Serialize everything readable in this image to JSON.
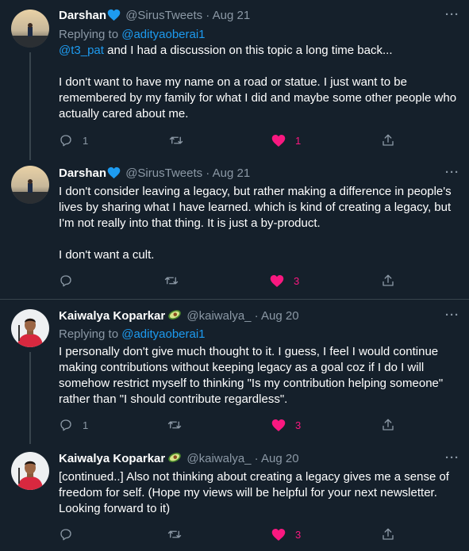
{
  "tweets": [
    {
      "name": "Darshan",
      "handle": "@SirusTweets",
      "sep": "·",
      "date": "Aug 21",
      "replying_prefix": "Replying to",
      "replying_to": "@adityaoberai1",
      "mention": "@t3_pat",
      "lines": [
        " and I had a discussion on this topic a long time back...",
        "I don't want to have my name on a road or statue. I just want to be",
        "remembered by my family for what I did and maybe some other people who",
        "actually cared about me."
      ],
      "replies": "1",
      "retweets": "",
      "likes": "1"
    },
    {
      "name": "Darshan",
      "handle": "@SirusTweets",
      "sep": "·",
      "date": "Aug 21",
      "lines": [
        "I don't consider leaving a legacy, but rather making a difference in people's",
        "lives by sharing what I have learned. which is kind of creating a legacy, but",
        "I'm not really into that thing. It is just a by-product.",
        "I don't want a cult."
      ],
      "replies": "",
      "retweets": "",
      "likes": "3"
    },
    {
      "name": "Kaiwalya Koparkar",
      "handle": "@kaiwalya_",
      "sep": "·",
      "date": "Aug 20",
      "replying_prefix": "Replying to",
      "replying_to": "@adityaoberai1",
      "lines": [
        "I personally don't give much thought to it. I guess, I feel I would continue",
        "making contributions without keeping legacy as a goal coz if I do I will",
        "somehow restrict myself to thinking \"Is my contribution helping someone\"",
        "rather than \"I should contribute regardless\"."
      ],
      "replies": "1",
      "retweets": "",
      "likes": "3"
    },
    {
      "name": "Kaiwalya Koparkar",
      "handle": "@kaiwalya_",
      "sep": "·",
      "date": "Aug 20",
      "lines": [
        "[continued..] Also not thinking about creating a legacy gives me a sense of",
        "freedom for self. (Hope my views will be helpful for your next newsletter.",
        "Looking forward to it)"
      ],
      "replies": "",
      "retweets": "",
      "likes": "3"
    }
  ],
  "more_label": "···",
  "colors": {
    "background": "#15202b",
    "divider": "#38444d",
    "secondary_text": "#8b98a5",
    "link": "#1d9bf0",
    "like": "#f91880",
    "verified": "#1d9bf0"
  },
  "icons": {
    "reply": "reply-icon",
    "retweet": "retweet-icon",
    "like": "heart-icon",
    "share": "share-icon",
    "verified": "verified-heart-icon",
    "emoji": "avocado-emoji-icon"
  }
}
